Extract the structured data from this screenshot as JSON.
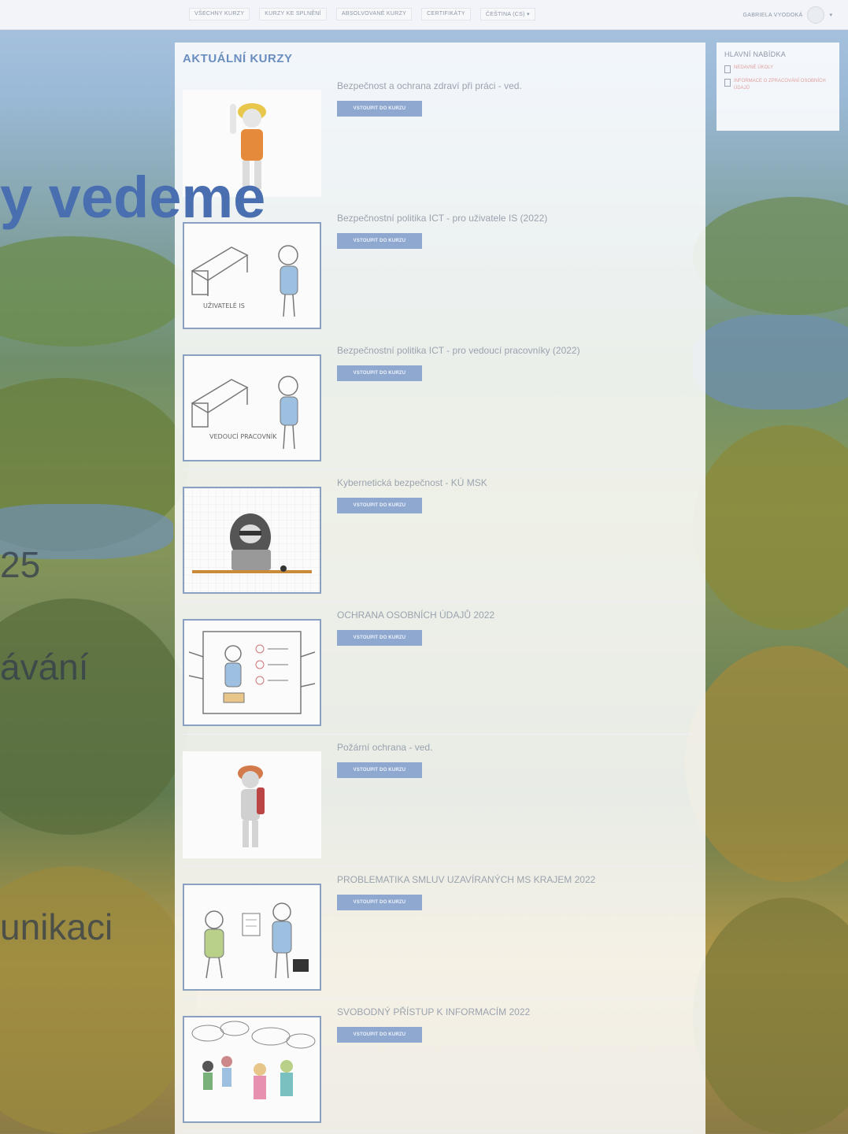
{
  "nav": {
    "items": [
      {
        "label": "VŠECHNY KURZY"
      },
      {
        "label": "KURZY KE SPLNĚNÍ"
      },
      {
        "label": "ABSOLVOVANÉ KURZY"
      },
      {
        "label": "CERTIFIKÁTY"
      },
      {
        "label": "ČEŠTINA (CS) ▾"
      }
    ]
  },
  "user": {
    "name": "GABRIELA VYODOKÁ"
  },
  "background_slide": {
    "heading": "y vedeme",
    "lines": [
      "25",
      "ávání",
      "unikaci"
    ]
  },
  "main": {
    "title": "AKTUÁLNÍ KURZY",
    "enter_label": "VSTOUPIT DO KURZU",
    "courses": [
      {
        "title": "Bezpečnost a ochrana zdraví při práci - ved."
      },
      {
        "title": "Bezpečnostní politika ICT - pro uživatele IS (2022)"
      },
      {
        "title": "Bezpečnostní politika ICT - pro vedoucí pracovníky (2022)"
      },
      {
        "title": "Kybernetická bezpečnost - KÚ MSK"
      },
      {
        "title": "OCHRANA OSOBNÍCH ÚDAJŮ 2022"
      },
      {
        "title": "Požární ochrana - ved."
      },
      {
        "title": "PROBLEMATIKA SMLUV UZAVÍRANÝCH MS KRAJEM 2022"
      },
      {
        "title": "SVOBODNÝ PŘÍSTUP K INFORMACÍM 2022"
      }
    ]
  },
  "side": {
    "title": "HLAVNÍ NABÍDKA",
    "links": [
      {
        "label": "NEDAVNÉ ÚKOLY"
      },
      {
        "label": "INFORMACE O ZPRACOVÁNÍ OSOBNÍCH ÚDAJŮ"
      }
    ]
  },
  "thumb_texts": {
    "users_is": "UŽIVATELÉ IS",
    "managers": "VEDOUCÍ PRACOVNÍK"
  }
}
